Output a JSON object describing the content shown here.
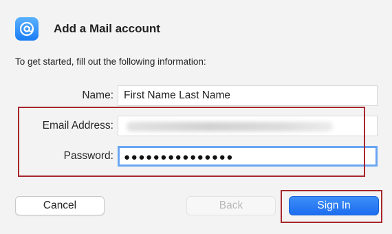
{
  "header": {
    "title": "Add a Mail account",
    "icon": "at-sign-icon"
  },
  "intro": "To get started, fill out the following information:",
  "form": {
    "name": {
      "label": "Name:",
      "value": "First Name Last Name"
    },
    "email": {
      "label": "Email Address:"
    },
    "password": {
      "label": "Password:",
      "value": "●●●●●●●●●●●●●●●"
    }
  },
  "buttons": {
    "cancel": "Cancel",
    "back": "Back",
    "sign_in": "Sign In"
  },
  "colors": {
    "accent": "#1d6df0",
    "highlight": "#a8262c"
  }
}
